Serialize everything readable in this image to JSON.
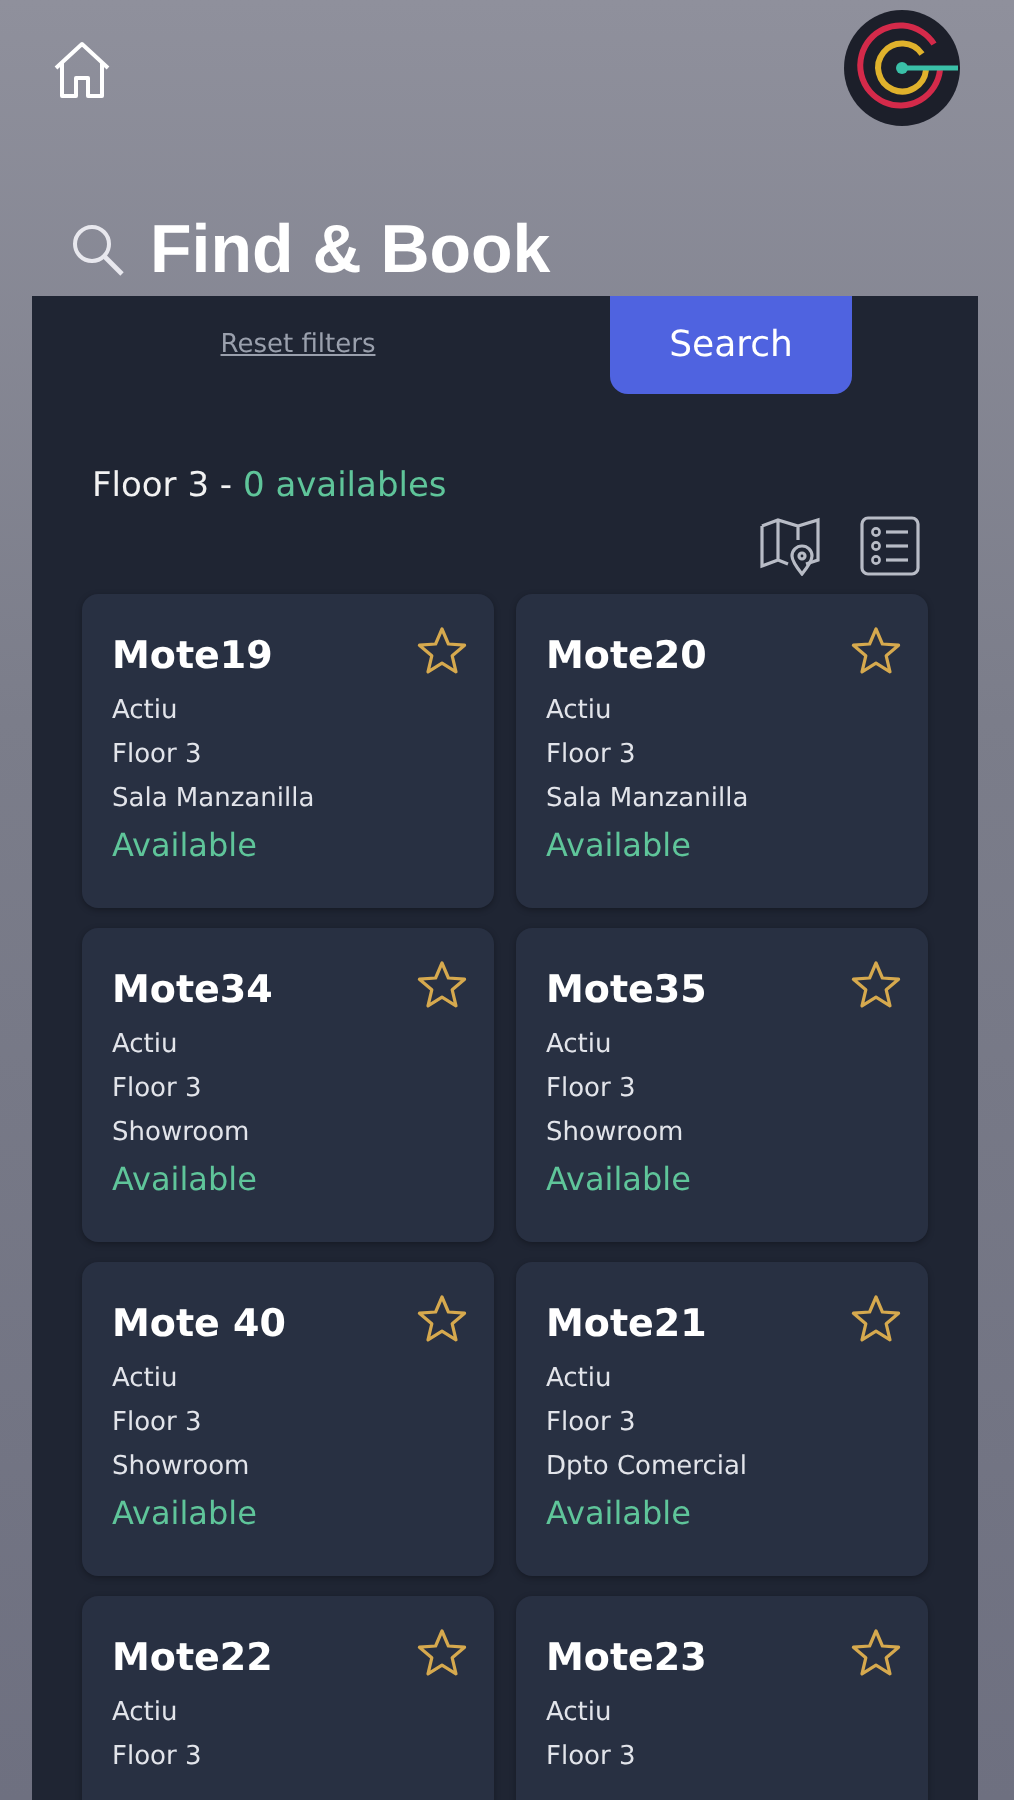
{
  "header": {
    "title": "Find & Book"
  },
  "filters": {
    "reset": "Reset filters",
    "search": "Search"
  },
  "summary": {
    "floor": "Floor 3 - ",
    "count": "0 availables"
  },
  "view": [
    {
      "kind": "map",
      "selected": false
    },
    {
      "kind": "list",
      "selected": false
    }
  ],
  "rooms": [
    {
      "name": "Mote19",
      "lines": [
        "Actiu",
        "Floor 3",
        "Sala Manzanilla"
      ],
      "status": "Available",
      "favorite": false
    },
    {
      "name": "Mote20",
      "lines": [
        "Actiu",
        "Floor 3",
        "Sala Manzanilla"
      ],
      "status": "Available",
      "favorite": false
    },
    {
      "name": "Mote34",
      "lines": [
        "Actiu",
        "Floor 3",
        "Showroom"
      ],
      "status": "Available",
      "favorite": false
    },
    {
      "name": "Mote35",
      "lines": [
        "Actiu",
        "Floor 3",
        "Showroom"
      ],
      "status": "Available",
      "favorite": false
    },
    {
      "name": "Mote 40",
      "lines": [
        "Actiu",
        "Floor 3",
        "Showroom"
      ],
      "status": "Available",
      "favorite": false
    },
    {
      "name": "Mote21",
      "lines": [
        "Actiu",
        "Floor 3",
        "Dpto Comercial"
      ],
      "status": "Available",
      "favorite": false
    },
    {
      "name": "Mote22",
      "lines": [
        "Actiu",
        "Floor 3"
      ],
      "favorite": false
    },
    {
      "name": "Mote23",
      "lines": [
        "Actiu",
        "Floor 3"
      ],
      "favorite": false
    }
  ]
}
